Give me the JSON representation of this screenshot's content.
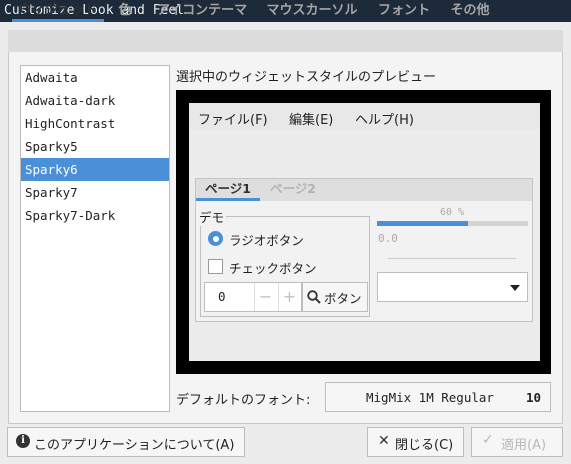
{
  "window": {
    "title": "Customize Look and Feel"
  },
  "tabs": [
    {
      "label": "ウィジェット",
      "active": true
    },
    {
      "label": "色",
      "active": false
    },
    {
      "label": "アイコンテーマ",
      "active": false
    },
    {
      "label": "マウスカーソル",
      "active": false
    },
    {
      "label": "フォント",
      "active": false
    },
    {
      "label": "その他",
      "active": false
    }
  ],
  "themes": {
    "items": [
      "Adwaita",
      "Adwaita-dark",
      "HighContrast",
      "Sparky5",
      "Sparky6",
      "Sparky7",
      "Sparky7-Dark"
    ],
    "selected": "Sparky6"
  },
  "preview": {
    "label": "選択中のウィジェットスタイルのプレビュー",
    "menu": [
      "ファイル(F)",
      "編集(E)",
      "ヘルプ(H)"
    ],
    "notebook_tabs": [
      "ページ1",
      "ページ2"
    ],
    "frame_label": "デモ",
    "radio_label": "ラジオボタン",
    "radio_checked": true,
    "check_label": "チェックボタン",
    "check_checked": false,
    "spin_value": "0",
    "spin_minus": "−",
    "spin_plus": "+",
    "button_label": "ボタン",
    "progress_text": "60 %",
    "progress_fraction": 0.6,
    "scale_value": "0.0"
  },
  "font": {
    "label": "デフォルトのフォント:",
    "name": "MigMix 1M Regular",
    "size": "10"
  },
  "footer": {
    "about_label": "このアプリケーションについて(A)",
    "close_label": "閉じる(C)",
    "apply_label": "適用(A)"
  },
  "colors": {
    "accent": "#4a90d9",
    "titlebar": "#1c2a3a"
  }
}
